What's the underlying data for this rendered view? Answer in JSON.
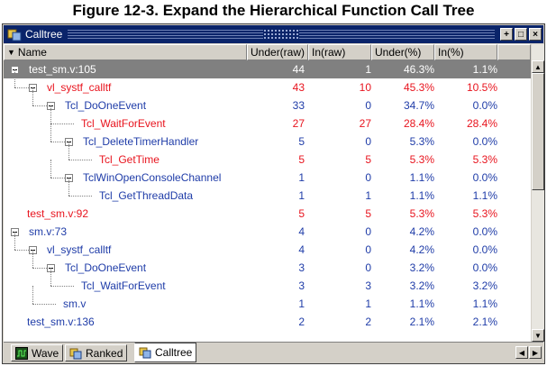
{
  "figure_title": "Figure 12-3. Expand the Hierarchical Function Call Tree",
  "window": {
    "title": "Calltree",
    "buttons": [
      "+",
      "□",
      "×"
    ]
  },
  "columns": [
    "Name",
    "Under(raw)",
    "In(raw)",
    "Under(%)",
    "In(%)"
  ],
  "colors": {
    "red": "#e8141e",
    "blue": "#1f3ca8",
    "selected_bg": "#808080"
  },
  "rows": [
    {
      "name": "test_sm.v:105",
      "under_raw": "44",
      "in_raw": "1",
      "under_pct": "46.3%",
      "in_pct": "1.1%",
      "color": "selected",
      "depth": 0,
      "expander": true
    },
    {
      "name": "vl_systf_calltf",
      "under_raw": "43",
      "in_raw": "10",
      "under_pct": "45.3%",
      "in_pct": "10.5%",
      "color": "red",
      "depth": 1,
      "expander": true
    },
    {
      "name": "Tcl_DoOneEvent",
      "under_raw": "33",
      "in_raw": "0",
      "under_pct": "34.7%",
      "in_pct": "0.0%",
      "color": "blue",
      "depth": 2,
      "expander": true
    },
    {
      "name": "Tcl_WaitForEvent",
      "under_raw": "27",
      "in_raw": "27",
      "under_pct": "28.4%",
      "in_pct": "28.4%",
      "color": "red",
      "depth": 3,
      "expander": false
    },
    {
      "name": "Tcl_DeleteTimerHandler",
      "under_raw": "5",
      "in_raw": "0",
      "under_pct": "5.3%",
      "in_pct": "0.0%",
      "color": "blue",
      "depth": 3,
      "expander": true
    },
    {
      "name": "Tcl_GetTime",
      "under_raw": "5",
      "in_raw": "5",
      "under_pct": "5.3%",
      "in_pct": "5.3%",
      "color": "red",
      "depth": 4,
      "expander": false
    },
    {
      "name": "TclWinOpenConsoleChannel",
      "under_raw": "1",
      "in_raw": "0",
      "under_pct": "1.1%",
      "in_pct": "0.0%",
      "color": "blue",
      "depth": 3,
      "expander": true
    },
    {
      "name": "Tcl_GetThreadData",
      "under_raw": "1",
      "in_raw": "1",
      "under_pct": "1.1%",
      "in_pct": "1.1%",
      "color": "blue",
      "depth": 4,
      "expander": false
    },
    {
      "name": "test_sm.v:92",
      "under_raw": "5",
      "in_raw": "5",
      "under_pct": "5.3%",
      "in_pct": "5.3%",
      "color": "red",
      "depth": 0,
      "expander": false
    },
    {
      "name": "sm.v:73",
      "under_raw": "4",
      "in_raw": "0",
      "under_pct": "4.2%",
      "in_pct": "0.0%",
      "color": "blue",
      "depth": 0,
      "expander": true
    },
    {
      "name": "vl_systf_calltf",
      "under_raw": "4",
      "in_raw": "0",
      "under_pct": "4.2%",
      "in_pct": "0.0%",
      "color": "blue",
      "depth": 1,
      "expander": true
    },
    {
      "name": "Tcl_DoOneEvent",
      "under_raw": "3",
      "in_raw": "0",
      "under_pct": "3.2%",
      "in_pct": "0.0%",
      "color": "blue",
      "depth": 2,
      "expander": true
    },
    {
      "name": "Tcl_WaitForEvent",
      "under_raw": "3",
      "in_raw": "3",
      "under_pct": "3.2%",
      "in_pct": "3.2%",
      "color": "blue",
      "depth": 3,
      "expander": false
    },
    {
      "name": "sm.v",
      "under_raw": "1",
      "in_raw": "1",
      "under_pct": "1.1%",
      "in_pct": "1.1%",
      "color": "blue",
      "depth": 2,
      "expander": false
    },
    {
      "name": "test_sm.v:136",
      "under_raw": "2",
      "in_raw": "2",
      "under_pct": "2.1%",
      "in_pct": "2.1%",
      "color": "blue",
      "depth": 0,
      "expander": false
    }
  ],
  "tabs": [
    {
      "label": "Wave",
      "icon": "wave-icon",
      "active": false
    },
    {
      "label": "Ranked",
      "icon": "ranked-icon",
      "active": false
    },
    {
      "label": "Calltree",
      "icon": "calltree-icon",
      "active": true
    }
  ]
}
